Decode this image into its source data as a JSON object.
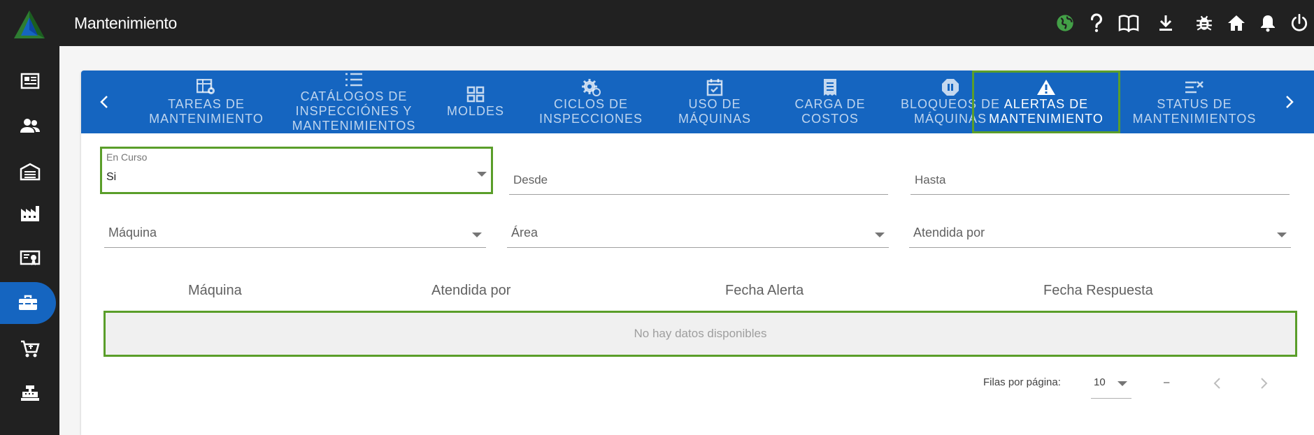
{
  "header": {
    "title": "Mantenimiento",
    "icons": [
      "language-icon",
      "help-icon",
      "book-icon",
      "download-icon",
      "bug-icon",
      "home-icon",
      "bell-icon",
      "power-icon"
    ]
  },
  "sidebar": {
    "items": [
      {
        "icon": "newspaper-icon"
      },
      {
        "icon": "users-icon"
      },
      {
        "icon": "warehouse-icon"
      },
      {
        "icon": "factory-icon"
      },
      {
        "icon": "certificate-icon"
      },
      {
        "icon": "toolbox-icon",
        "active": true
      },
      {
        "icon": "cart-icon"
      },
      {
        "icon": "cash-register-icon"
      }
    ]
  },
  "tabs": [
    {
      "label": "TAREAS DE\nMANTENIMIENTO",
      "icon": "table-gear-icon"
    },
    {
      "label": "CATÁLOGOS DE\nINSPECCIÓNES Y\nMANTENIMIENTOS",
      "icon": "list-icon"
    },
    {
      "label": "MOLDES",
      "icon": "grid-icon"
    },
    {
      "label": "CICLOS DE\nINSPECCIONES",
      "icon": "cog-refresh-icon"
    },
    {
      "label": "USO DE\nMÁQUINAS",
      "icon": "calendar-check-icon"
    },
    {
      "label": "CARGA DE\nCOSTOS",
      "icon": "receipt-icon"
    },
    {
      "label": "BLOQUEOS DE\nMÁQUINAS",
      "icon": "pause-octagon-icon"
    },
    {
      "label": "ALERTAS DE\nMANTENIMIENTO",
      "icon": "alert-icon",
      "active": true
    },
    {
      "label": "STATUS DE\nMANTENIMIENTOS",
      "icon": "list-check-icon"
    }
  ],
  "filters": {
    "en_curso": {
      "label": "En Curso",
      "value": "Si"
    },
    "desde": {
      "placeholder": "Desde"
    },
    "hasta": {
      "placeholder": "Hasta"
    },
    "maquina": {
      "placeholder": "Máquina"
    },
    "area": {
      "placeholder": "Área"
    },
    "atendida_por": {
      "placeholder": "Atendida por"
    }
  },
  "table": {
    "headers": [
      "Máquina",
      "Atendida por",
      "Fecha Alerta",
      "Fecha Respuesta"
    ],
    "empty_message": "No hay datos disponibles"
  },
  "pagination": {
    "rows_label": "Filas por página:",
    "rows_value": "10",
    "range": "–"
  },
  "colors": {
    "topbar": "#212121",
    "primary": "#1565c0",
    "highlight": "#5a9e2a"
  }
}
